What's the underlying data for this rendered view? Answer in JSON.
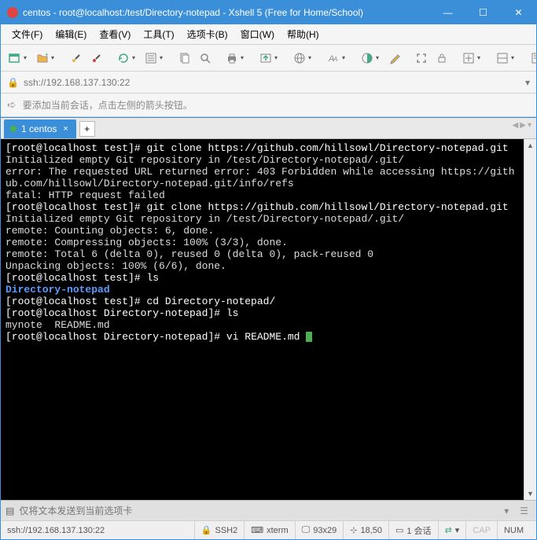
{
  "window": {
    "title": "centos - root@localhost:/test/Directory-notepad - Xshell 5 (Free for Home/School)"
  },
  "menubar": {
    "items": [
      "文件(F)",
      "编辑(E)",
      "查看(V)",
      "工具(T)",
      "选项卡(B)",
      "窗口(W)",
      "帮助(H)"
    ]
  },
  "address": {
    "url": "ssh://192.168.137.130:22"
  },
  "info": {
    "text": "要添加当前会话，点击左侧的箭头按钮。"
  },
  "tab": {
    "label": "1 centos"
  },
  "terminal": {
    "lines": [
      {
        "seg": [
          {
            "cls": "prompt",
            "t": "[root@localhost test]# "
          },
          {
            "cls": "cmd",
            "t": "git clone https://github.com/hillsowl/Directory-notepad.git"
          }
        ]
      },
      {
        "seg": [
          {
            "cls": "",
            "t": "Initialized empty Git repository in /test/Directory-notepad/.git/"
          }
        ]
      },
      {
        "seg": [
          {
            "cls": "",
            "t": "error: The requested URL returned error: 403 Forbidden while accessing https://github.com/hillsowl/Directory-notepad.git/info/refs"
          }
        ]
      },
      {
        "seg": [
          {
            "cls": "",
            "t": ""
          }
        ]
      },
      {
        "seg": [
          {
            "cls": "",
            "t": "fatal: HTTP request failed"
          }
        ]
      },
      {
        "seg": [
          {
            "cls": "prompt",
            "t": "[root@localhost test]# "
          },
          {
            "cls": "cmd",
            "t": "git clone https://github.com/hillsowl/Directory-notepad.git"
          }
        ]
      },
      {
        "seg": [
          {
            "cls": "",
            "t": "Initialized empty Git repository in /test/Directory-notepad/.git/"
          }
        ]
      },
      {
        "seg": [
          {
            "cls": "",
            "t": "remote: Counting objects: 6, done."
          }
        ]
      },
      {
        "seg": [
          {
            "cls": "",
            "t": "remote: Compressing objects: 100% (3/3), done."
          }
        ]
      },
      {
        "seg": [
          {
            "cls": "",
            "t": "remote: Total 6 (delta 0), reused 0 (delta 0), pack-reused 0"
          }
        ]
      },
      {
        "seg": [
          {
            "cls": "",
            "t": "Unpacking objects: 100% (6/6), done."
          }
        ]
      },
      {
        "seg": [
          {
            "cls": "prompt",
            "t": "[root@localhost test]# "
          },
          {
            "cls": "cmd",
            "t": "ls"
          }
        ]
      },
      {
        "seg": [
          {
            "cls": "blue",
            "t": "Directory-notepad"
          }
        ]
      },
      {
        "seg": [
          {
            "cls": "prompt",
            "t": "[root@localhost test]# "
          },
          {
            "cls": "cmd",
            "t": "cd Directory-notepad/"
          }
        ]
      },
      {
        "seg": [
          {
            "cls": "prompt",
            "t": "[root@localhost Directory-notepad]# "
          },
          {
            "cls": "cmd",
            "t": "ls"
          }
        ]
      },
      {
        "seg": [
          {
            "cls": "",
            "t": "mynote  README.md"
          }
        ]
      },
      {
        "seg": [
          {
            "cls": "prompt",
            "t": "[root@localhost Directory-notepad]# "
          },
          {
            "cls": "cmd",
            "t": "vi README.md "
          },
          {
            "cls": "cursor",
            "t": ""
          }
        ]
      }
    ]
  },
  "inputbar": {
    "placeholder": "仅将文本发送到当前选项卡"
  },
  "status": {
    "left": "ssh://192.168.137.130:22",
    "ssh": "SSH2",
    "term": "xterm",
    "size": "93x29",
    "pos": "18,50",
    "sessions": "1 会话",
    "caps": "CAP",
    "num": "NUM"
  },
  "icons": {
    "minimize": "—",
    "maximize": "☐",
    "close": "✕",
    "lock": "🔒",
    "arrow": "➪",
    "plus": "+",
    "left": "◀",
    "right": "▶",
    "down": "▾",
    "monitor": "🖵",
    "net": "↹",
    "caret": "⌄"
  }
}
